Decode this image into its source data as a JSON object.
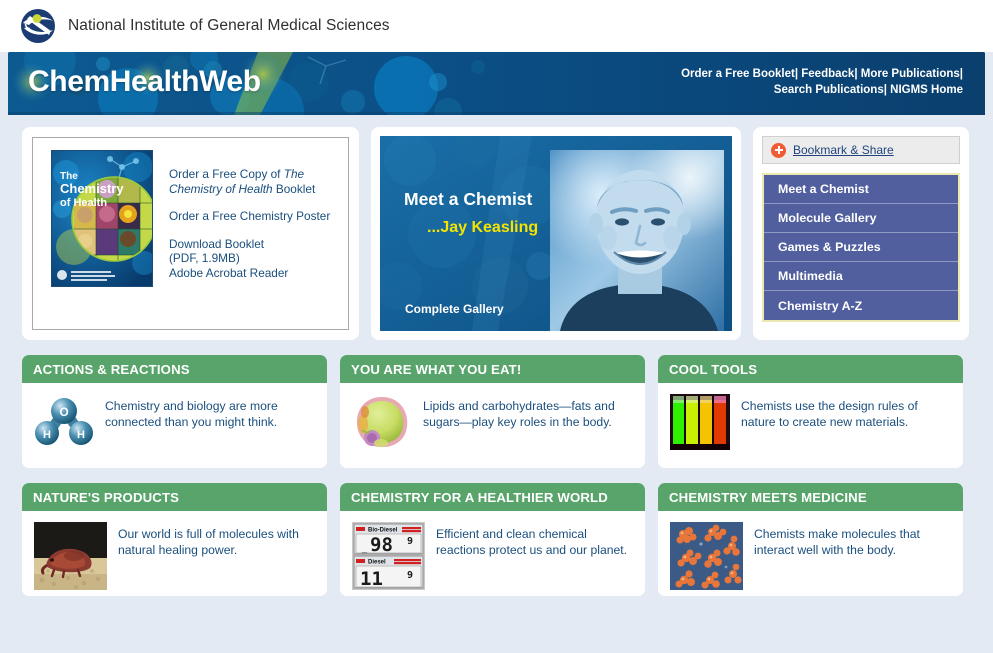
{
  "agency": {
    "name": "National Institute of General Medical Sciences",
    "logo_icon": "nigms-swoosh-logo"
  },
  "banner": {
    "title": "ChemHealthWeb",
    "links": [
      "Order a Free Booklet",
      "Feedback",
      "More Publications",
      "Search Publications",
      "NIGMS Home"
    ],
    "separator": "|",
    "bg_color": "#0b4f86"
  },
  "booklet": {
    "cover_title_line1": "The",
    "cover_title_line2": "Chemistry",
    "cover_title_line3": "of Health",
    "links": [
      {
        "prefix": "Order a Free Copy of ",
        "italic": "The Chemistry of Health",
        "suffix": " Booklet"
      }
    ],
    "link2": "Order a Free Chemistry Poster",
    "link3_line1": "Download Booklet",
    "link3_line2": "(PDF, 1.9MB)",
    "link4": "Adobe Acrobat Reader"
  },
  "chemist": {
    "title": "Meet a Chemist",
    "name": "...Jay Keasling",
    "gallery_label": "Complete Gallery"
  },
  "sidebar": {
    "bookmark_label": "Bookmark & Share",
    "bookmark_icon": "plus-circle-icon",
    "items": [
      {
        "label": "Meet a Chemist"
      },
      {
        "label": "Molecule Gallery"
      },
      {
        "label": "Games & Puzzles"
      },
      {
        "label": "Multimedia"
      },
      {
        "label": "Chemistry A-Z"
      }
    ],
    "item_color": "#515f9f",
    "border_color": "#ece9b0"
  },
  "features": {
    "header_color": "#58a46b",
    "text_color": "#1a4f7e",
    "row1": [
      {
        "title": "ACTIONS & REACTIONS",
        "text": "Chemistry and biology are more connected than you might think.",
        "thumb": "water-molecule-icon"
      },
      {
        "title": "YOU ARE WHAT YOU EAT!",
        "text": "Lipids and carbohydrates—fats and sugars—play key roles in the body.",
        "thumb": "cell-lipid-image"
      },
      {
        "title": "COOL TOOLS",
        "text": "Chemists use the design rules of nature to create new materials.",
        "thumb": "fluorescent-vials-image"
      }
    ],
    "row2": [
      {
        "title": "NATURE'S PRODUCTS",
        "text": "Our world is full of molecules with natural healing power.",
        "thumb": "sea-creature-image"
      },
      {
        "title": "CHEMISTRY FOR A HEALTHIER WORLD",
        "text": "Efficient and clean chemical reactions protect us and our planet.",
        "thumb": "biodiesel-pump-image",
        "pump_label_top": "Bio-Diesel",
        "pump_label_bottom": "Diesel",
        "pump_price_top": "98",
        "pump_price_top_sup": "9",
        "pump_price_bottom": "11",
        "pump_price_bottom_sup": "9"
      },
      {
        "title": "CHEMISTRY MEETS MEDICINE",
        "text": "Chemists make molecules that interact well with the body.",
        "thumb": "molecule-cluster-image"
      }
    ]
  }
}
